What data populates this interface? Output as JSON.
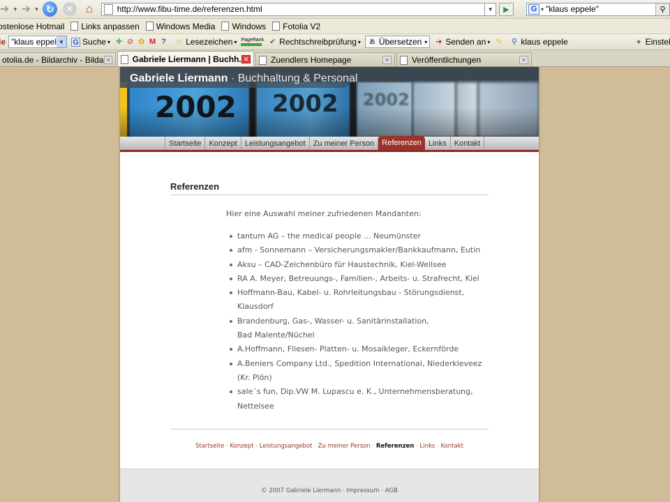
{
  "browser": {
    "url": "http://www.fibu-time.de/referenzen.html",
    "search_value": "\"klaus eppele\"",
    "search_engine_icon": "G",
    "links_bar": [
      "ostenlose Hotmail",
      "Links anpassen",
      "Windows Media",
      "Windows",
      "Fotolia V2"
    ],
    "toolbar": {
      "prefix": "le",
      "combo_value": "\"klaus eppel",
      "search_label": "Suche",
      "bookmarks_label": "Lesezeichen",
      "pagerank_label": "PageRank",
      "spellcheck_label": "Rechtschreibprüfung",
      "translate_label": "Übersetzen",
      "send_label": "Senden an",
      "user_label": "klaus eppele",
      "settings_label": "Einstellu"
    },
    "tabs": [
      {
        "label": "otolia.de - Bildarchiv - Bildage...",
        "active": false
      },
      {
        "label": "Gabriele Liermann | Buchh...",
        "active": true
      },
      {
        "label": "Zuendlers Homepage",
        "active": false
      },
      {
        "label": "Veröffentlichungen",
        "active": false
      }
    ]
  },
  "site": {
    "owner": "Gabriele Liermann",
    "subtitle": " · Buchhaltung & Personal",
    "header_year": "2002",
    "nav": [
      "Startseite",
      "Konzept",
      "Leistungsangebot",
      "Zu meiner Person",
      "Referenzen",
      "Links",
      "Kontakt"
    ],
    "nav_active": "Referenzen"
  },
  "content": {
    "title": "Referenzen",
    "intro": "Hier eine Auswahl meiner zufriedenen Mandanten:",
    "clients": [
      [
        "tantum AG – the medical people ... Neumünster"
      ],
      [
        "afm - Sonnemann – Versicherungsmakler/Bankkaufmann, Eutin"
      ],
      [
        "Aksu – CAD-Zeichenbüro für Haustechnik, Kiel-Wellsee"
      ],
      [
        "RA A. Meyer, Betreuungs-, Familien-, Arbeits- u. Strafrecht, Kiel"
      ],
      [
        "Hoffmann-Bau, Kabel- u. Rohrleitungsbau - Störungsdienst,",
        "Klausdorf"
      ],
      [
        "Brandenburg, Gas-, Wasser- u. Sanitärinstallation,",
        "Bad Malente/Nüchel"
      ],
      [
        "A.Hoffmann, Fliesen- Platten- u. Mosaikleger, Eckernförde"
      ],
      [
        "A.Beniers Company Ltd., Spedition International, Niederkleveez",
        "(Kr. Plön)"
      ],
      [
        "sale´s fun,  Dip.VW M. Lupascu e. K., Unternehmensberatung,",
        "Nettelsee"
      ]
    ]
  },
  "footer": {
    "links": [
      "Startseite",
      "Konzept",
      "Leistungsangebot",
      "Zu meiner Person",
      "Referenzen",
      "Links",
      "Kontakt"
    ],
    "current": "Referenzen",
    "separator": " · ",
    "copyright": "© 2007 Gabriele Liermann · Impressum · AGB"
  }
}
